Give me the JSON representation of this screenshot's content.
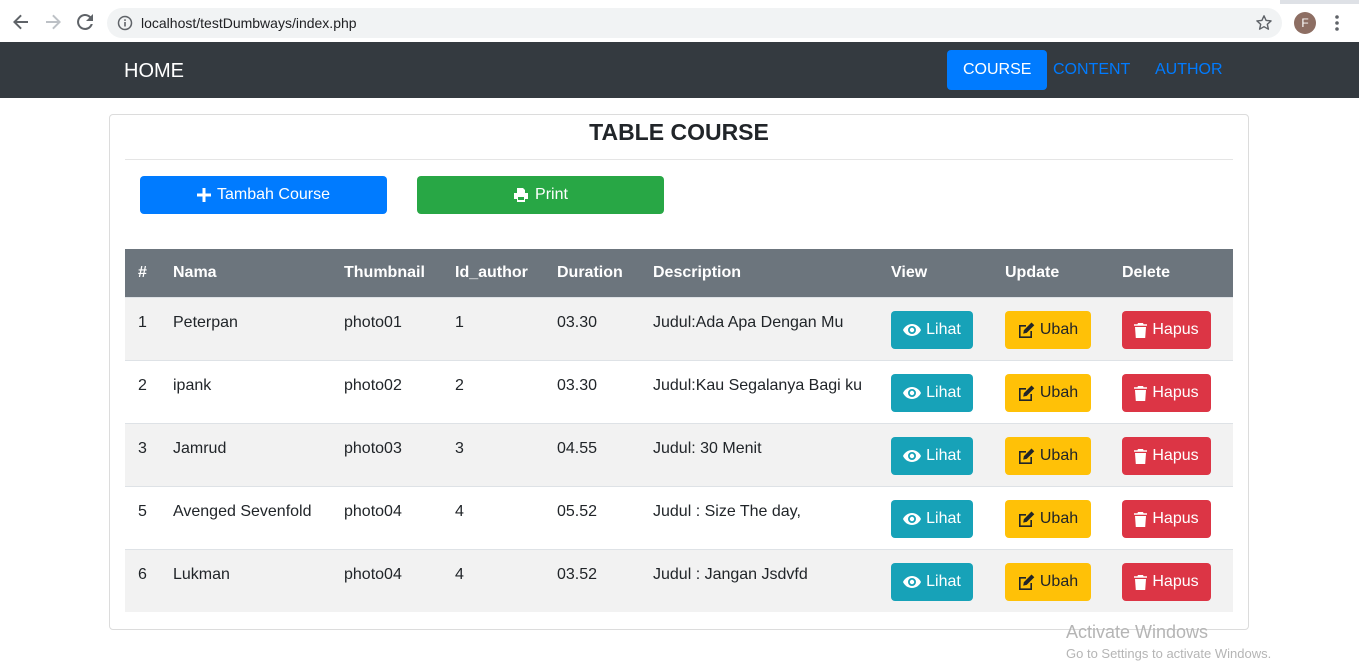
{
  "browser": {
    "url": "localhost/testDumbways/index.php",
    "avatar_letter": "F"
  },
  "navbar": {
    "brand": "HOME",
    "items": [
      {
        "label": "COURSE",
        "active": true
      },
      {
        "label": "CONTENT",
        "active": false
      },
      {
        "label": "AUTHOR",
        "active": false
      }
    ]
  },
  "card": {
    "title": "TABLE COURSE",
    "add_button": "Tambah Course",
    "print_button": "Print"
  },
  "table": {
    "headers": [
      "#",
      "Nama",
      "Thumbnail",
      "Id_author",
      "Duration",
      "Description",
      "View",
      "Update",
      "Delete"
    ],
    "rows": [
      {
        "no": "1",
        "nama": "Peterpan",
        "thumbnail": "photo01",
        "id_author": "1",
        "duration": "03.30",
        "description": "Judul:Ada Apa Dengan Mu"
      },
      {
        "no": "2",
        "nama": "ipank",
        "thumbnail": "photo02",
        "id_author": "2",
        "duration": "03.30",
        "description": "Judul:Kau Segalanya Bagi ku"
      },
      {
        "no": "3",
        "nama": "Jamrud",
        "thumbnail": "photo03",
        "id_author": "3",
        "duration": "04.55",
        "description": "Judul: 30 Menit"
      },
      {
        "no": "5",
        "nama": "Avenged Sevenfold",
        "thumbnail": "photo04",
        "id_author": "4",
        "duration": "05.52",
        "description": "Judul : Size The day,"
      },
      {
        "no": "6",
        "nama": "Lukman",
        "thumbnail": "photo04",
        "id_author": "4",
        "duration": "03.52",
        "description": "Judul : Jangan Jsdvfd"
      }
    ],
    "actions": {
      "view": "Lihat",
      "update": "Ubah",
      "delete": "Hapus"
    }
  },
  "watermark": {
    "line1": "Activate Windows",
    "line2": "Go to Settings to activate Windows."
  },
  "colors": {
    "navbar_bg": "#343a40",
    "primary": "#007bff",
    "success": "#28a745",
    "info": "#17a2b8",
    "warning": "#ffc107",
    "danger": "#dc3545",
    "table_head": "#6c757d"
  }
}
